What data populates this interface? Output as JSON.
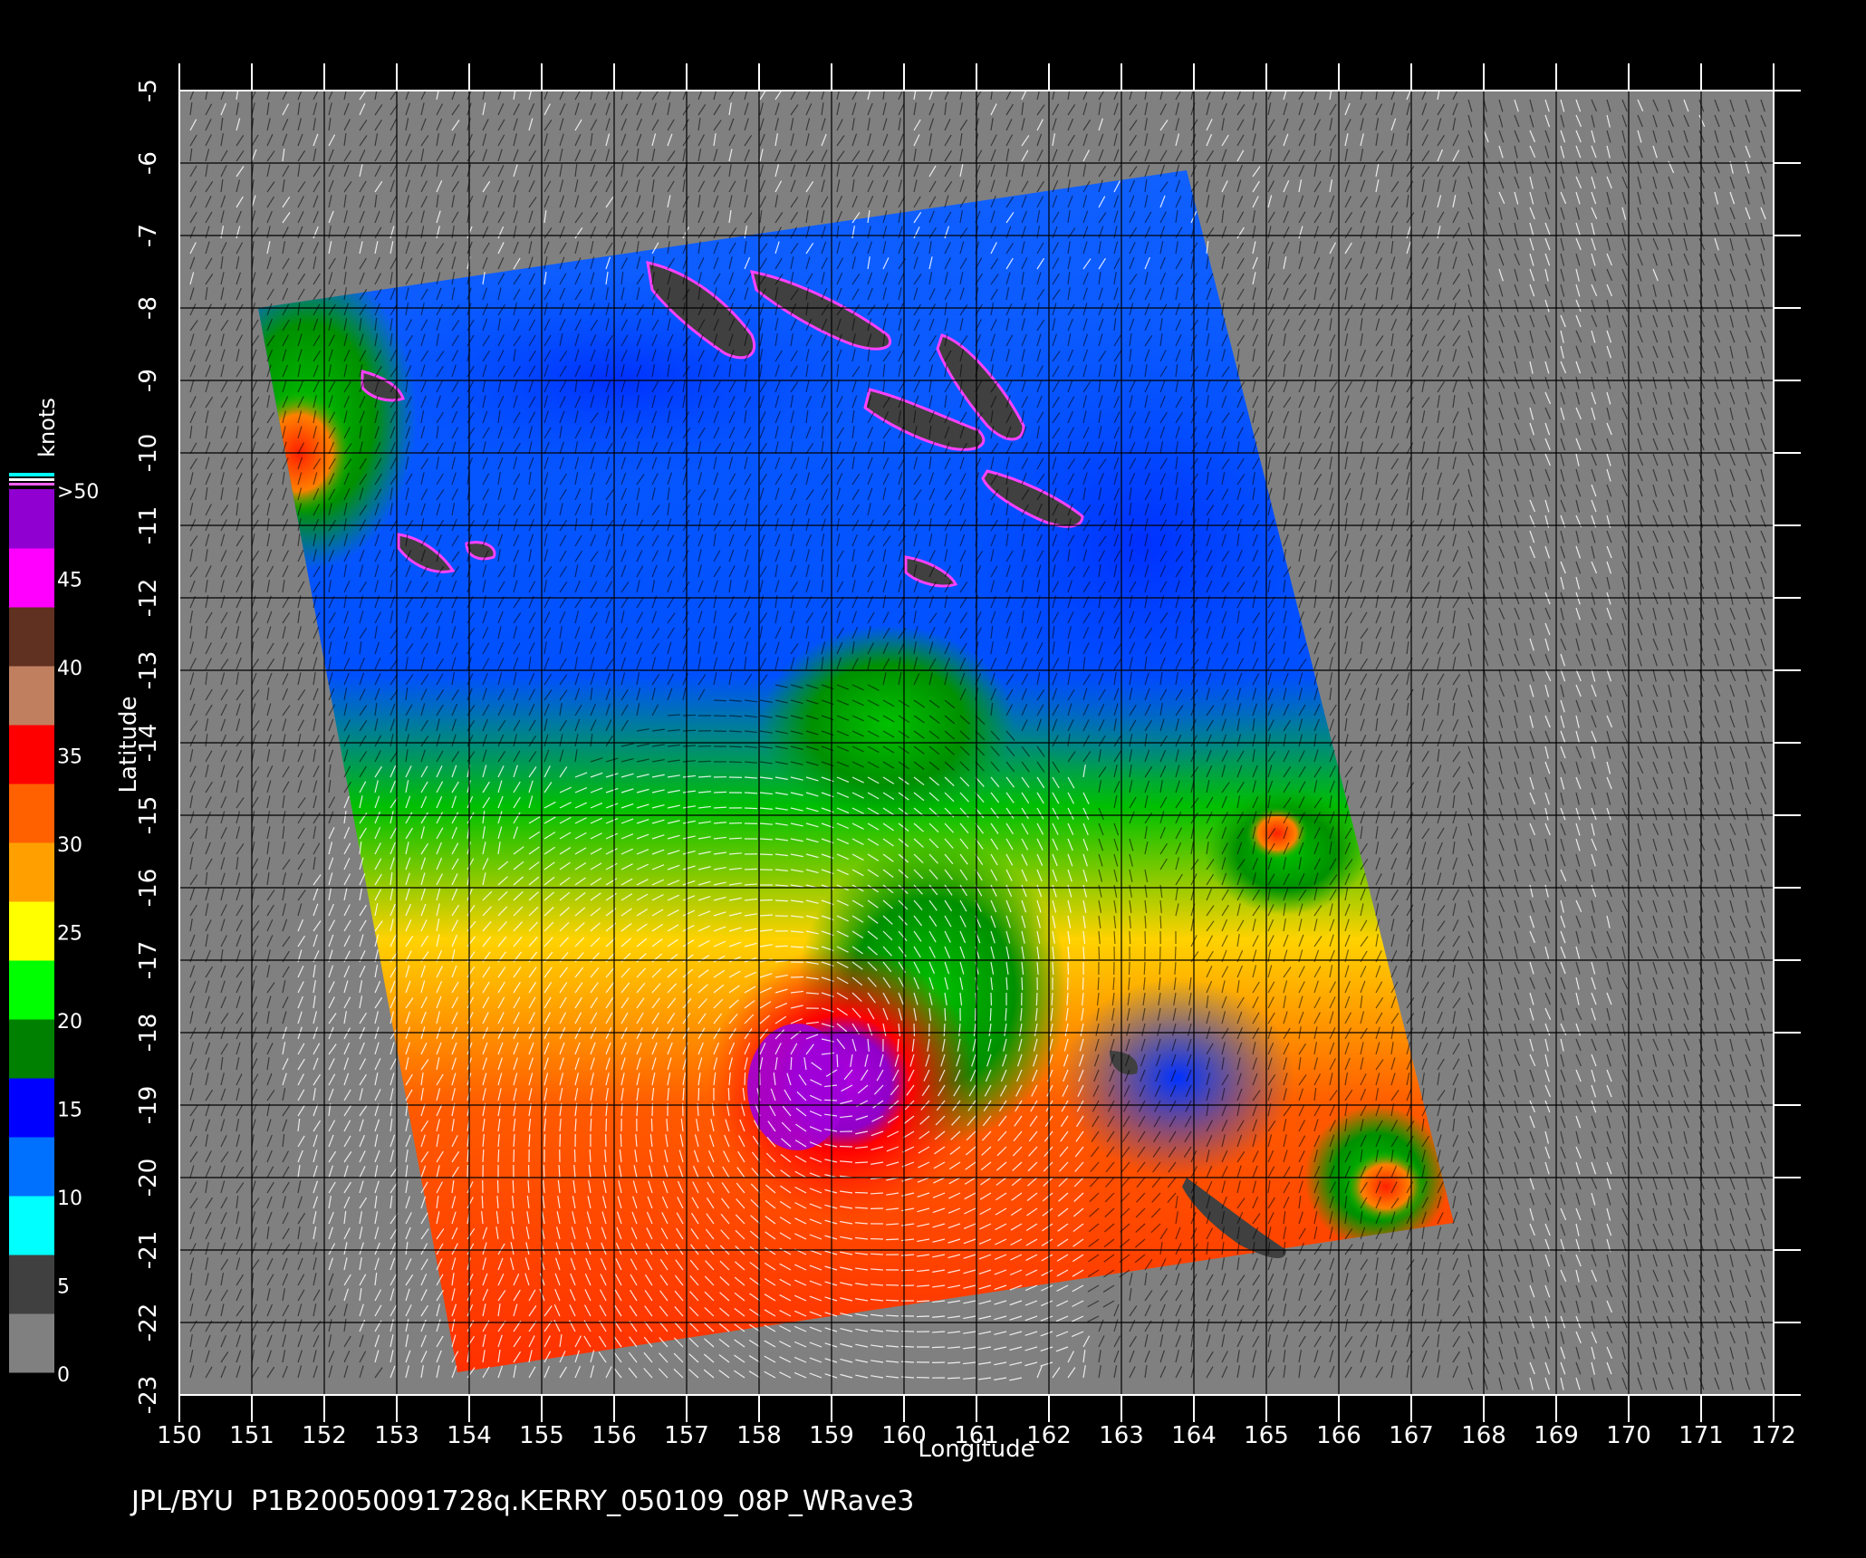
{
  "map": {
    "xaxis": {
      "label": "Longitude",
      "ticks": [
        "150",
        "151",
        "152",
        "153",
        "154",
        "155",
        "156",
        "157",
        "158",
        "159",
        "160",
        "161",
        "162",
        "163",
        "164",
        "165",
        "166",
        "167",
        "168",
        "169",
        "170",
        "171",
        "172"
      ]
    },
    "yaxis": {
      "label": "Latitude",
      "ticks": [
        "-5",
        "-6",
        "-7",
        "-8",
        "-9",
        "-10",
        "-11",
        "-12",
        "-13",
        "-14",
        "-15",
        "-16",
        "-17",
        "-18",
        "-19",
        "-20",
        "-21",
        "-22",
        "-23"
      ]
    },
    "grid": true,
    "background_color": "#808080"
  },
  "colorbar": {
    "unit": "knots",
    "labels": [
      ">50",
      "45",
      "40",
      "35",
      "30",
      "25",
      "20",
      "15",
      "10",
      "5",
      "0"
    ],
    "scale_colors": [
      "#808080",
      "#404040",
      "#00ffff",
      "#0070ff",
      "#0000ff",
      "#008000",
      "#00ff00",
      "#ffff00",
      "#ffa000",
      "#ff6000",
      "#ff0000",
      "#c08060",
      "#603020",
      "#ff00ff",
      "#9000d0"
    ]
  },
  "footer": {
    "text": "JPL/BYU  P1B20050091728q.KERRY_050109_08P_WRave3"
  },
  "features": {
    "storm_name": "KERRY",
    "storm_id": "08P",
    "max_wind_knots": 50
  }
}
